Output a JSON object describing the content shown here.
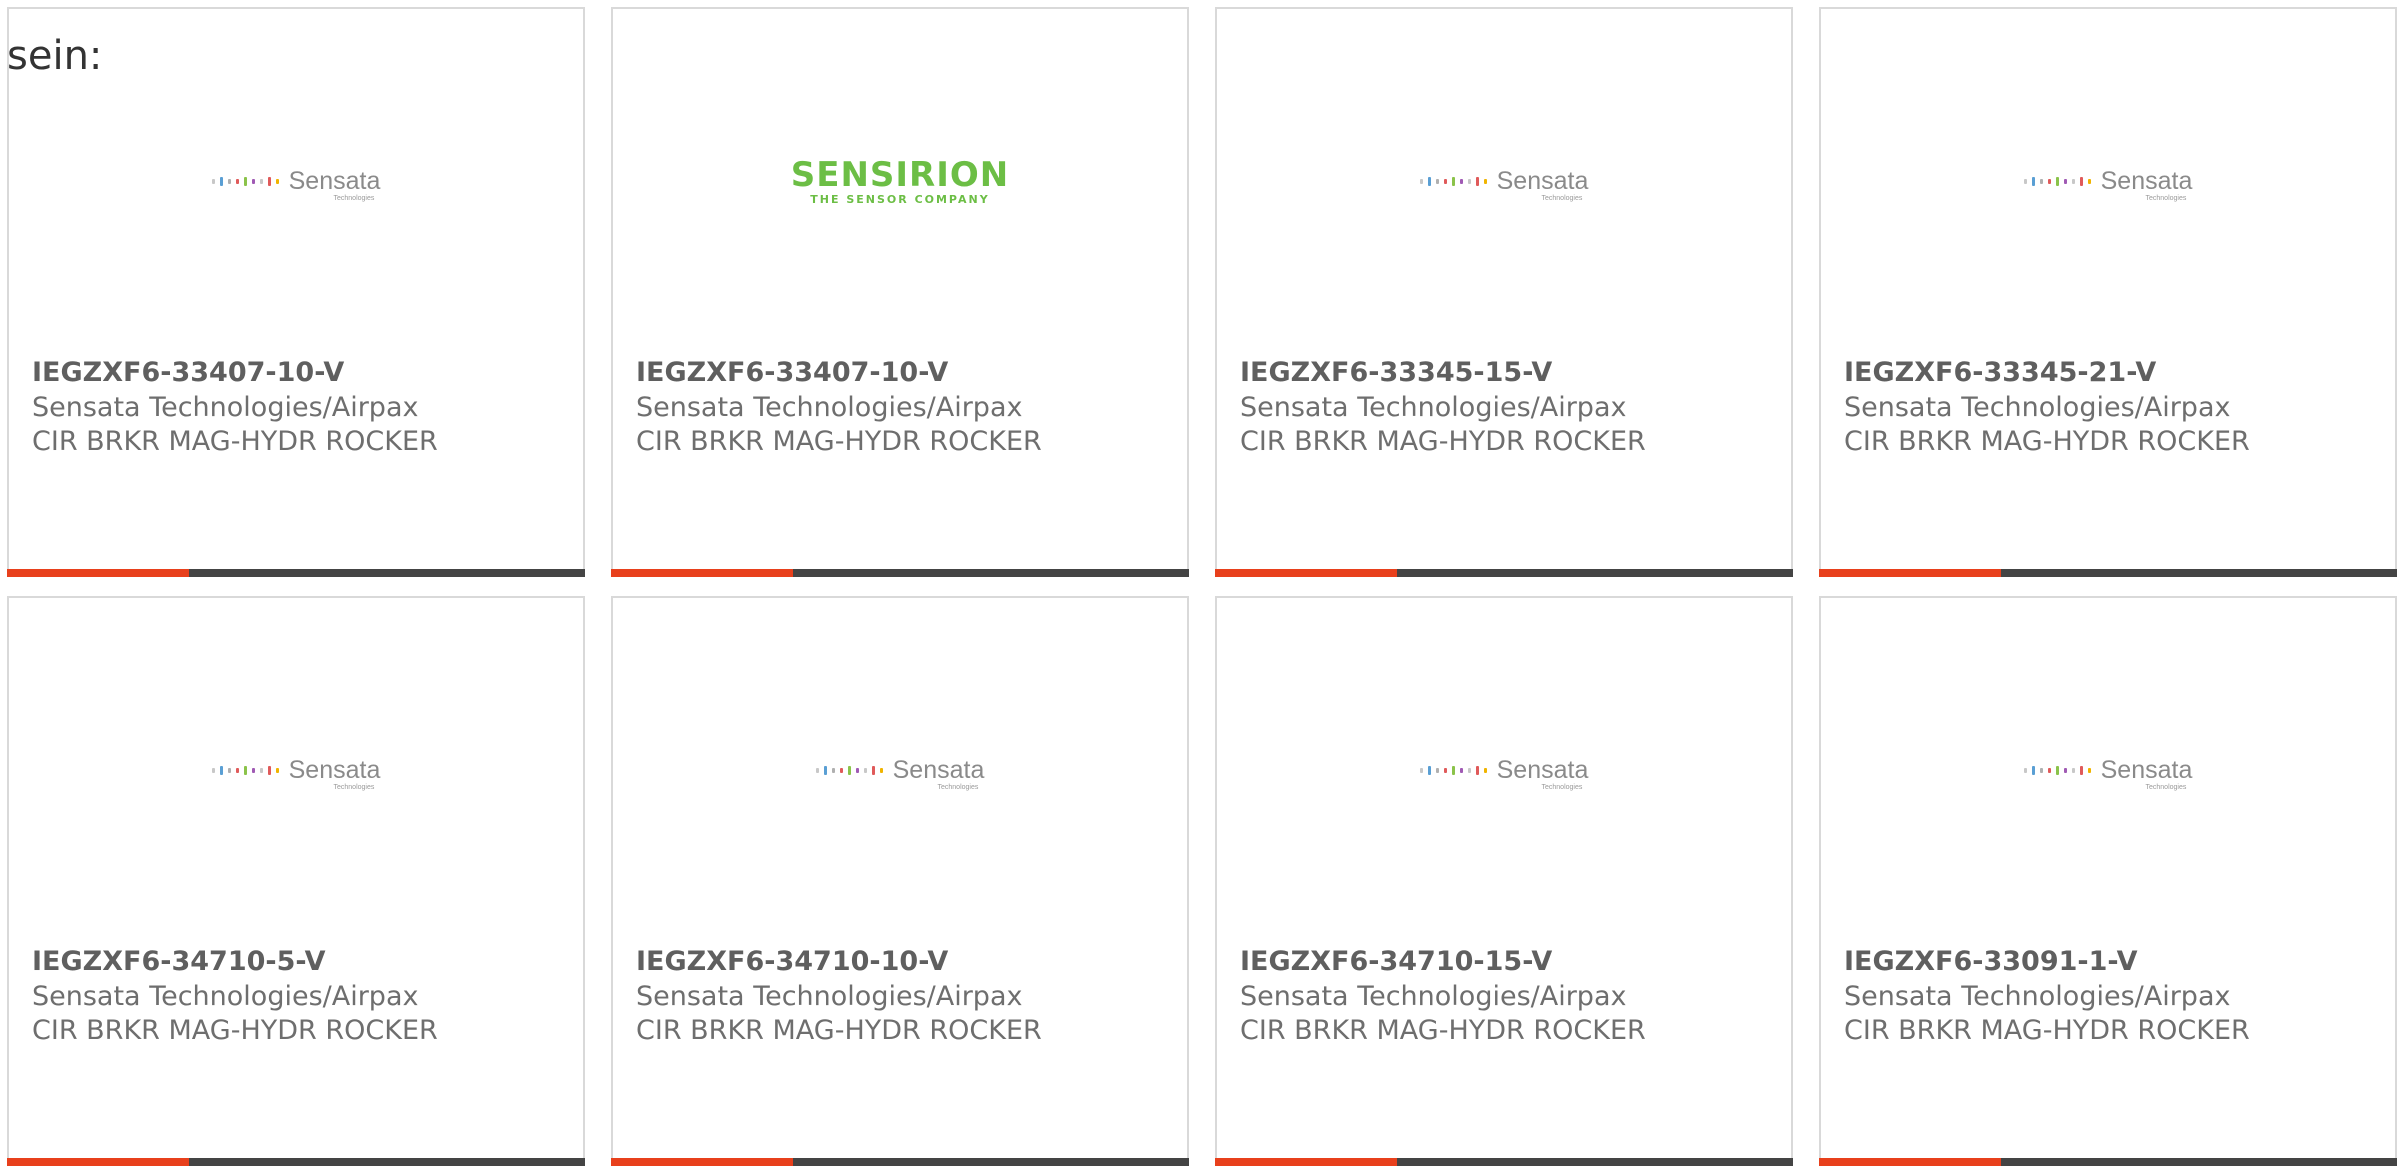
{
  "intro_text": "sein:",
  "colors": {
    "accent": "#e8401c",
    "bar": "#444444",
    "border": "#d9d9d9",
    "sensirion_green": "#6cbe45"
  },
  "cards": [
    {
      "part_number": "IEGZXF6-33407-10-V",
      "manufacturer": "Sensata Technologies/Airpax",
      "description": "CIR BRKR MAG-HYDR ROCKER",
      "logo": "sensata-logo",
      "logo_text": "Sensata",
      "logo_subtext": "Technologies"
    },
    {
      "part_number": "IEGZXF6-33407-10-V",
      "manufacturer": "Sensata Technologies/Airpax",
      "description": "CIR BRKR MAG-HYDR ROCKER",
      "logo": "sensirion-logo",
      "logo_text": "SENSIRION",
      "logo_subtext": "THE SENSOR COMPANY"
    },
    {
      "part_number": "IEGZXF6-33345-15-V",
      "manufacturer": "Sensata Technologies/Airpax",
      "description": "CIR BRKR MAG-HYDR ROCKER",
      "logo": "sensata-logo",
      "logo_text": "Sensata",
      "logo_subtext": "Technologies"
    },
    {
      "part_number": "IEGZXF6-33345-21-V",
      "manufacturer": "Sensata Technologies/Airpax",
      "description": "CIR BRKR MAG-HYDR ROCKER",
      "logo": "sensata-logo",
      "logo_text": "Sensata",
      "logo_subtext": "Technologies"
    },
    {
      "part_number": "IEGZXF6-34710-5-V",
      "manufacturer": "Sensata Technologies/Airpax",
      "description": "CIR BRKR MAG-HYDR ROCKER",
      "logo": "sensata-logo",
      "logo_text": "Sensata",
      "logo_subtext": "Technologies"
    },
    {
      "part_number": "IEGZXF6-34710-10-V",
      "manufacturer": "Sensata Technologies/Airpax",
      "description": "CIR BRKR MAG-HYDR ROCKER",
      "logo": "sensata-logo",
      "logo_text": "Sensata",
      "logo_subtext": "Technologies"
    },
    {
      "part_number": "IEGZXF6-34710-15-V",
      "manufacturer": "Sensata Technologies/Airpax",
      "description": "CIR BRKR MAG-HYDR ROCKER",
      "logo": "sensata-logo",
      "logo_text": "Sensata",
      "logo_subtext": "Technologies"
    },
    {
      "part_number": "IEGZXF6-33091-1-V",
      "manufacturer": "Sensata Technologies/Airpax",
      "description": "CIR BRKR MAG-HYDR ROCKER",
      "logo": "sensata-logo",
      "logo_text": "Sensata",
      "logo_subtext": "Technologies"
    }
  ]
}
